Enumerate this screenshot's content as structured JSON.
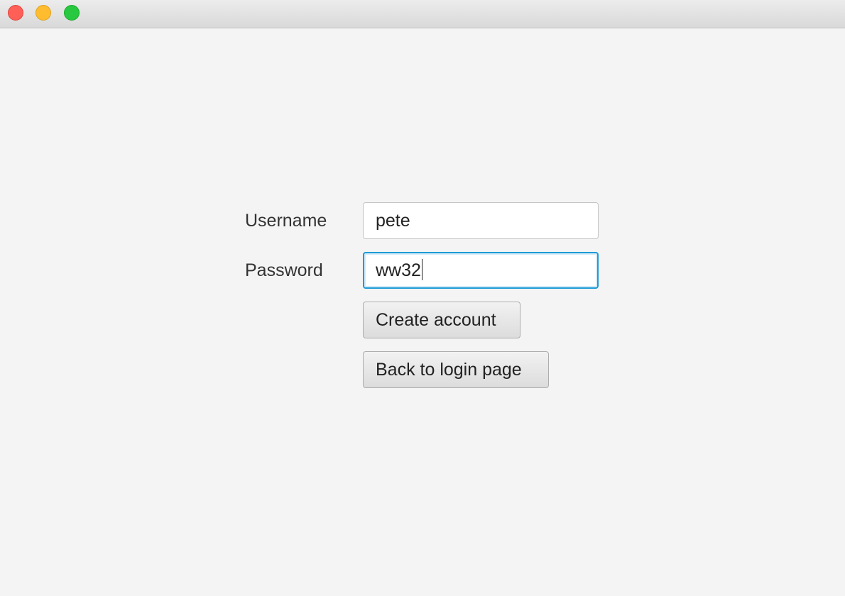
{
  "window": {
    "controls": {
      "close_color": "#fe5f57",
      "minimize_color": "#febc2e",
      "maximize_color": "#28c840"
    }
  },
  "form": {
    "username_label": "Username",
    "username_value": "pete",
    "password_label": "Password",
    "password_value": "ww32",
    "focused_field": "password",
    "focus_color": "#1e9bd7"
  },
  "buttons": {
    "create_account": "Create account",
    "back_to_login": "Back to login page"
  }
}
